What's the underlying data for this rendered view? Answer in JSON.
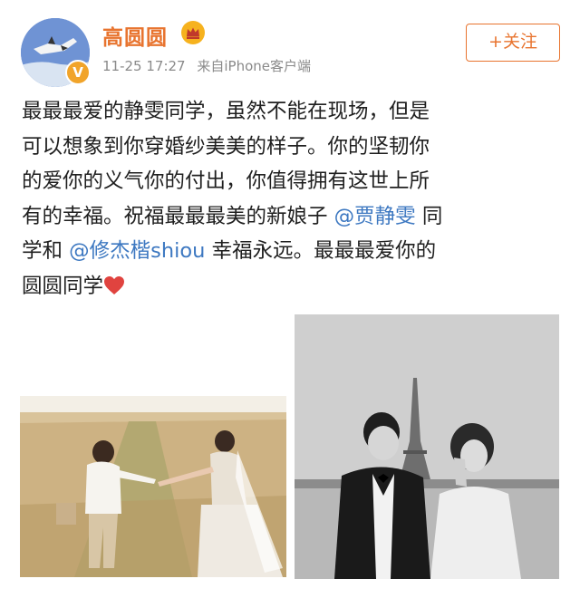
{
  "post": {
    "author": {
      "name": "高圆圆",
      "verified_badge": "V",
      "crown_icon": "crown-icon"
    },
    "timestamp": "11-25 17:27",
    "source": "来自iPhone客户端",
    "follow_label": "+关注",
    "lines": {
      "l1": "最最最爱的静雯同学，虽然不能在现场，但是",
      "l2": "可以想象到你穿婚纱美美的样子。你的坚韧你",
      "l3": "的爱你的义气你的付出，你值得拥有这世上所",
      "l4": "有的幸福。祝福最最最美的新娘子 ",
      "l4_mention": "@贾静雯",
      "l4_end": " 同",
      "l5_start": "学和 ",
      "l5_mention": "@修杰楷shiou",
      "l5_end": " 幸福永远。最最最爱你的",
      "l6": "圆圆同学"
    },
    "colors": {
      "accent": "#e8742f",
      "mention": "#3d78c1",
      "meta": "#8a8a8a",
      "heart": "#e0433f"
    }
  }
}
